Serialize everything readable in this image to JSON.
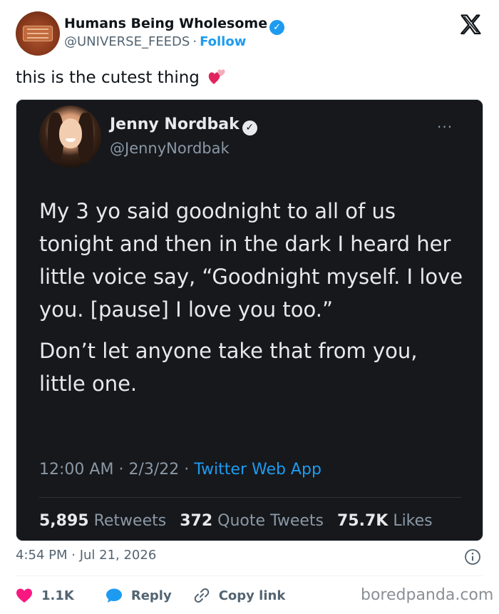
{
  "post": {
    "author_name": "Humans Being Wholesome",
    "author_handle": "@UNIVERSE_FEEDS",
    "separator": "·",
    "follow_label": "Follow",
    "text": "this is the cutest thing"
  },
  "embedded_tweet": {
    "name": "Jenny Nordbak",
    "handle": "@JennyNordbak",
    "more_label": "···",
    "paragraphs": [
      "My 3 yo said goodnight to all of us tonight and then in the dark I heard her little voice say, “Goodnight myself. I love you. [pause] I love you too.”",
      "Don’t let anyone take that from you, little one."
    ],
    "time": "12:00 AM",
    "date": "2/3/22",
    "separator": "·",
    "app": "Twitter Web App",
    "retweets_count": "5,895",
    "retweets_label": "Retweets",
    "quotes_count": "372",
    "quotes_label": "Quote Tweets",
    "likes_count": "75.7K",
    "likes_label": "Likes"
  },
  "footer": {
    "timestamp": "4:54 PM · Jul 21, 2026",
    "like_count": "1.1K",
    "reply_label": "Reply",
    "copy_link_label": "Copy link",
    "watermark": "boredpanda.com"
  },
  "colors": {
    "accent": "#1d9bf0",
    "like": "#f91880",
    "card_bg": "#16181c"
  },
  "icons": [
    "verified-badge-icon",
    "x-logo-icon",
    "heart-emoji-icon",
    "more-icon",
    "info-icon",
    "heart-icon",
    "reply-icon",
    "link-icon"
  ]
}
